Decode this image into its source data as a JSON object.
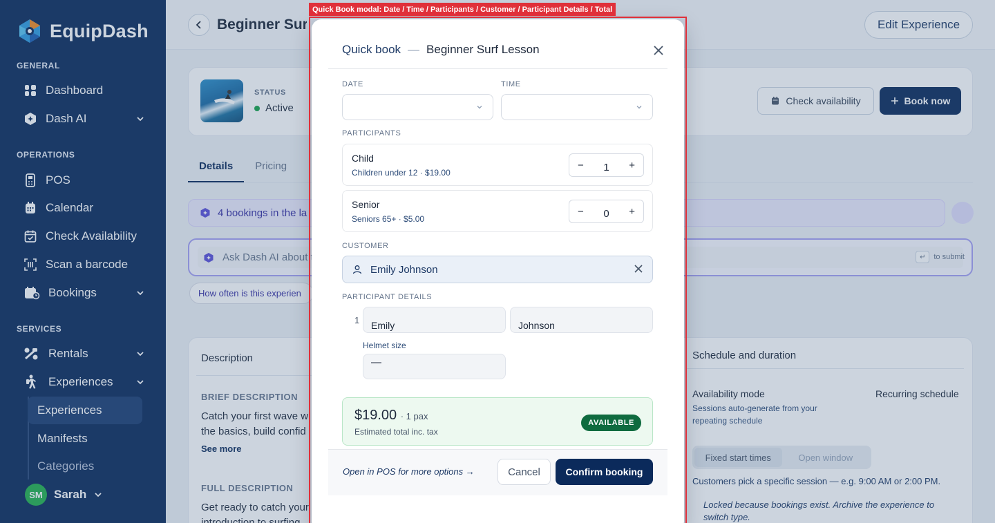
{
  "app": {
    "name": "EquipDash"
  },
  "sidebar": {
    "sections": {
      "general": "GENERAL",
      "operations": "OPERATIONS",
      "services": "SERVICES"
    },
    "items": {
      "dashboard": "Dashboard",
      "dash_ai": "Dash AI",
      "pos": "POS",
      "calendar": "Calendar",
      "check_availability": "Check Availability",
      "scan_barcode": "Scan a barcode",
      "bookings": "Bookings",
      "rentals": "Rentals",
      "experiences": "Experiences"
    },
    "sub_items": {
      "experiences": "Experiences",
      "manifests": "Manifests",
      "categories": "Categories"
    },
    "user": {
      "initials": "SM",
      "name": "Sarah"
    }
  },
  "page": {
    "title": "Beginner Surf",
    "edit_button": "Edit Experience",
    "status_label": "STATUS",
    "status_value": "Active",
    "check_availability": "Check availability",
    "book_now": "Book now",
    "tabs": [
      "Details",
      "Pricing"
    ],
    "ai_banner": "4 bookings in the la",
    "ask_placeholder": "Ask Dash AI about t",
    "ask_hint": "to submit",
    "chip": "How often is this experien",
    "description": {
      "header": "Description",
      "brief_label": "BRIEF DESCRIPTION",
      "brief_line1": "Catch your first wave w",
      "brief_line2": "the basics, build confid",
      "see_more": "See more",
      "full_label": "FULL DESCRIPTION",
      "full_line1": "Get ready to catch your",
      "full_line2": "introduction to surfing"
    },
    "schedule": {
      "header": "Schedule and duration",
      "availability_mode_label": "Availability mode",
      "availability_mode_value": "Recurring schedule",
      "availability_mode_sub": "Sessions auto-generate from your repeating schedule",
      "seg_fixed": "Fixed start times",
      "seg_window": "Open window",
      "note": "Customers pick a specific session — e.g. 9:00 AM or 2:00 PM.",
      "locked": "Locked because bookings exist. Archive the experience to switch type."
    }
  },
  "highlight": {
    "label": "Quick Book modal: Date / Time / Participants / Customer / Participant Details / Total"
  },
  "modal": {
    "quick_book": "Quick book",
    "separator": "—",
    "title": "Beginner Surf Lesson",
    "date_label": "DATE",
    "time_label": "TIME",
    "date_value": "",
    "time_value": "",
    "participants_label": "PARTICIPANTS",
    "participants": [
      {
        "name": "Child",
        "sub": "Children under 12 · $19.00",
        "qty": "1"
      },
      {
        "name": "Senior",
        "sub": "Seniors 65+ · $5.00",
        "qty": "0"
      }
    ],
    "stepper_minus": "−",
    "stepper_plus": "+",
    "customer_label": "CUSTOMER",
    "customer_value": "Emily Johnson",
    "participant_details_label": "PARTICIPANT DETAILS",
    "participant_index": "1",
    "first_name": "Emily",
    "last_name": "Johnson",
    "helmet_label": "Helmet size",
    "helmet_value": "—",
    "total_price": "$19.00",
    "total_pax": "· 1 pax",
    "total_sub": "Estimated total inc. tax",
    "available": "AVAILABLE",
    "pos_link": "Open in POS for more options →",
    "cancel": "Cancel",
    "confirm": "Confirm booking"
  },
  "colors": {
    "sidebar": "#0b2a5b",
    "accent": "#0b2a5b",
    "available": "#0f6b3f",
    "highlight": "#e0303a"
  }
}
